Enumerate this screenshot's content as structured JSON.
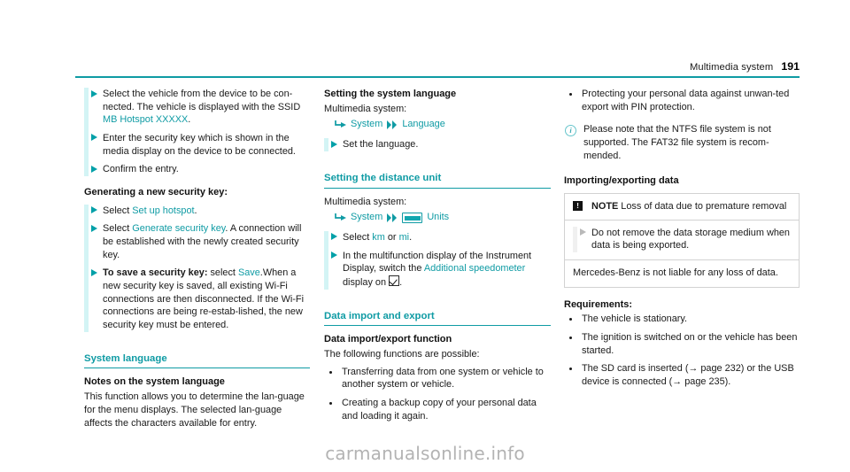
{
  "header": {
    "title": "Multimedia system",
    "page_number": "191"
  },
  "colors": {
    "teal": "#0f9ba4",
    "highlight_bar": "#d3f4f5",
    "text": "#1a1a1a",
    "watermark": "#b3b3b3"
  },
  "column1": {
    "steps_wifi": [
      {
        "pre": "Select the vehicle from the device to be con-nected. The vehicle is displayed with the SSID ",
        "link": "MB Hotspot XXXXX",
        "post": "."
      },
      {
        "pre": "Enter the security key which is shown in the media display on the device to be connected.",
        "link": "",
        "post": ""
      },
      {
        "pre": "Confirm the entry.",
        "link": "",
        "post": ""
      }
    ],
    "heading_generating": "Generating a new security key:",
    "steps_generate": [
      {
        "pre": "Select ",
        "link": "Set up hotspot",
        "post": "."
      },
      {
        "pre": "Select ",
        "link": "Generate security key",
        "post": ".\nA connection will be established with the newly created security key."
      }
    ],
    "step_save_bold": "To save a security key:",
    "step_save_pre": " select ",
    "step_save_link": "Save",
    "step_save_post": ".",
    "step_save_body": "When a new security key is saved, all existing Wi-Fi connections are then disconnected. If the Wi-Fi connections are being re-estab-lished, the new security key must be entered.",
    "heading_system_language": "System language",
    "heading_notes": "Notes on the system language",
    "notes_body": "This function allows you to determine the lan-guage for the menu displays. The selected lan-guage affects the characters available for entry."
  },
  "column2": {
    "heading_setting_language": "Setting the system language",
    "multimedia_label": "Multimedia system:",
    "navpath_language": {
      "corner_icon": "corner-arrow-icon",
      "item1": "System",
      "double_arrow_icon": "double-arrow-icon",
      "item2": "Language"
    },
    "step_set_language": "Set the language.",
    "heading_distance_unit": "Setting the distance unit",
    "multimedia_label2": "Multimedia system:",
    "navpath_units": {
      "corner_icon": "corner-arrow-icon",
      "item1": "System",
      "double_arrow_icon": "double-arrow-icon",
      "units_icon": "units-gauge-icon",
      "item2": "Units"
    },
    "step_select_pre": "Select ",
    "step_select_km": "km",
    "step_select_or": " or ",
    "step_select_mi": "mi",
    "step_select_post": ".",
    "step_mfd_pre": "In the multifunction display of the Instrument Display, switch the ",
    "step_mfd_link": "Additional speedometer",
    "step_mfd_mid": " display on ",
    "step_mfd_checkbox_icon": "checkbox-checked-icon",
    "step_mfd_post": ".",
    "heading_data_import": "Data import and export",
    "heading_data_func": "Data import/export function",
    "intro_functions": "The following functions are possible:",
    "bullets": [
      "Transferring data from one system or vehicle to another system or vehicle.",
      "Creating a backup copy of your personal data and loading it again."
    ]
  },
  "column3": {
    "bullet_pin": "Protecting your personal data against unwan-ted export with PIN protection.",
    "info_icon": "info-circle-icon",
    "info_text": "Please note that the NTFS file system is not supported. The FAT32 file system is recom-mended.",
    "heading_importing": "Importing/exporting data",
    "note_box": {
      "warn_icon": "warning-exclamation-icon",
      "label": "NOTE",
      "headline": " Loss of data due to premature removal",
      "step": "Do not remove the data storage medium when data is being exported.",
      "footer": "Mercedes-Benz is not liable for any loss of data."
    },
    "heading_requirements": "Requirements:",
    "requirements": [
      "The vehicle is stationary.",
      "The ignition is switched on or the vehicle has been started.",
      "The SD card is inserted (→ page 232) or the USB device is connected (→ page 235)."
    ]
  },
  "footer": {
    "watermark": "carmanualsonline.info"
  }
}
